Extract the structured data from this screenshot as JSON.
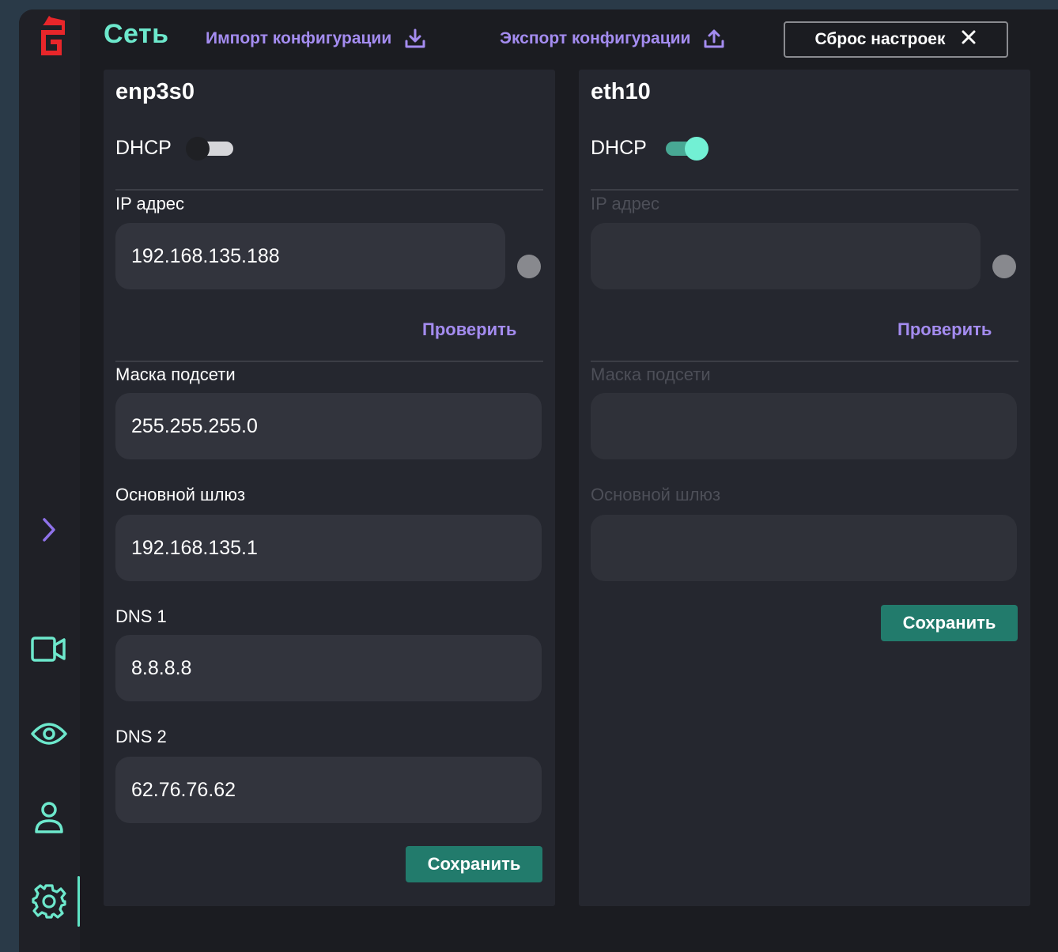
{
  "header": {
    "title": "Сеть",
    "import_label": "Импорт конфигурации",
    "export_label": "Экспорт конфигурации",
    "reset_label": "Сброс настроек"
  },
  "colors": {
    "accent": "#6de8cc",
    "link": "#a48cf0",
    "save": "#227b6c",
    "logo": "#e8262a"
  },
  "sidebar": {
    "icons": [
      "expand-chevron-icon",
      "camera-icon",
      "eye-icon",
      "user-icon",
      "settings-icon"
    ],
    "active": "settings-icon"
  },
  "interfaces": [
    {
      "name": "enp3s0",
      "dhcp_label": "DHCP",
      "dhcp_enabled": false,
      "ip_label": "IP адрес",
      "ip_value": "192.168.135.188",
      "check_label": "Проверить",
      "mask_label": "Маска подсети",
      "mask_value": "255.255.255.0",
      "gateway_label": "Основной шлюз",
      "gateway_value": "192.168.135.1",
      "dns1_label": "DNS 1",
      "dns1_value": "8.8.8.8",
      "dns2_label": "DNS 2",
      "dns2_value": "62.76.76.62",
      "save_label": "Сохранить"
    },
    {
      "name": "eth10",
      "dhcp_label": "DHCP",
      "dhcp_enabled": true,
      "ip_label": "IP адрес",
      "ip_value": "",
      "check_label": "Проверить",
      "mask_label": "Маска подсети",
      "mask_value": "",
      "gateway_label": "Основной шлюз",
      "gateway_value": "",
      "save_label": "Сохранить"
    }
  ]
}
